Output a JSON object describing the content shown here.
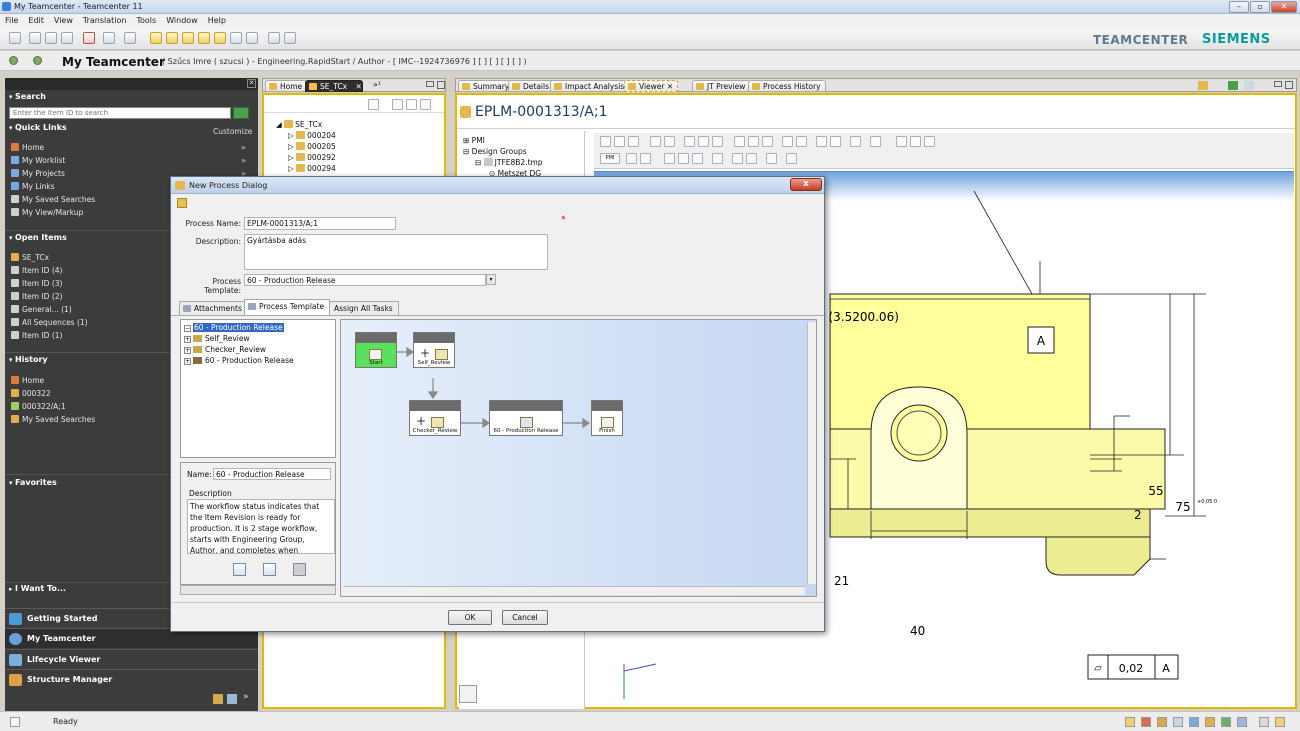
{
  "window": {
    "title": "My Teamcenter - Teamcenter 11",
    "minimize": "–",
    "maximize": "▫",
    "close": "✕"
  },
  "menu": [
    "File",
    "Edit",
    "View",
    "Translation",
    "Tools",
    "Window",
    "Help"
  ],
  "brand": {
    "teamcenter": "TEAMCENTER",
    "siemens": "SIEMENS"
  },
  "header": {
    "app_title": "My Teamcenter",
    "breadcrumb": "( Szűcs Imre ( szucsi ) - Engineering.RapidStart / Author - [ IMC--1924736976 ] [ ] [ ] [ ] [ ] )"
  },
  "leftnav": {
    "search": {
      "title": "Search",
      "placeholder": "Enter the Item ID to search"
    },
    "quick_links": {
      "title": "Quick Links",
      "customize": "Customize",
      "items": [
        "Home",
        "My Worklist",
        "My Projects",
        "My Links",
        "My Saved Searches",
        "My View/Markup"
      ]
    },
    "open_items": {
      "title": "Open Items",
      "items": [
        "SE_TCx",
        "Item ID (4)",
        "Item ID (3)",
        "Item ID (2)",
        "General... (1)",
        "All Sequences (1)",
        "Item ID (1)"
      ]
    },
    "history": {
      "title": "History",
      "items": [
        "Home",
        "000322",
        "000322/A;1",
        "My Saved Searches"
      ]
    },
    "favorites": {
      "title": "Favorites"
    },
    "i_want_to": {
      "title": "I Want To..."
    },
    "apps": [
      "Getting Started",
      "My Teamcenter",
      "Lifecycle Viewer",
      "Structure Manager"
    ],
    "more": "»"
  },
  "tree_pane": {
    "tabs": [
      "Home",
      "SE_TCx"
    ],
    "overflow": "»¹",
    "root": "SE_TCx",
    "items": [
      "000204",
      "000205",
      "000292",
      "000294"
    ]
  },
  "viewer_pane": {
    "tabs": [
      "Summary",
      "Details",
      "Impact Analysis",
      "Viewer",
      "JT Preview",
      "Process History"
    ],
    "item_title": "EPLM-0001313/A;1",
    "tree": [
      "PMI",
      "Design Groups",
      "JTFE8B2.tmp",
      "Metszet DG"
    ],
    "toolbar_btn": "PMI"
  },
  "drawing": {
    "dim_top": "0 (3.5200.06)",
    "datum": "A",
    "dim_55": "55",
    "dim_75": "75",
    "tol_75": "+0,05 0",
    "dim_2": "2",
    "dim_21": "21",
    "dim_40": "40",
    "flatness_symbol": "⏥",
    "flatness_value": "0,02",
    "flatness_datum": "A"
  },
  "dialog": {
    "title": "New Process Dialog",
    "close": "x",
    "process_name_label": "Process Name:",
    "process_name": "EPLM-0001313/A;1",
    "required": "*",
    "description_label": "Description:",
    "description": "Gyártásba adás",
    "template_label": "Process Template:",
    "template": "60 - Production Release",
    "tabs": [
      "Attachments",
      "Process Template",
      "Assign All Tasks"
    ],
    "tree": [
      "60 - Production Release",
      "Self_Review",
      "Checker_Review",
      "60 - Production Release"
    ],
    "info": {
      "name_label": "Name:",
      "name": "60 - Production Release",
      "desc_label": "Description",
      "desc": "The workflow status indicates that the Item Revision is ready for production. It is 2 stage workflow, starts with Engineering Group, Author, and completes when Manufacturing Group"
    },
    "flow": {
      "nodes": [
        "Start",
        "Self_Review",
        "Checker_Review",
        "60 - Production Release",
        "Finish"
      ],
      "plus": "+"
    },
    "ok": "OK",
    "cancel": "Cancel"
  },
  "status": {
    "text": "Ready"
  },
  "colors": {
    "accent": "#e3b900",
    "part": "#ffff9c",
    "nav_bg": "#3c3c3c",
    "start_node": "#5ae15a"
  }
}
